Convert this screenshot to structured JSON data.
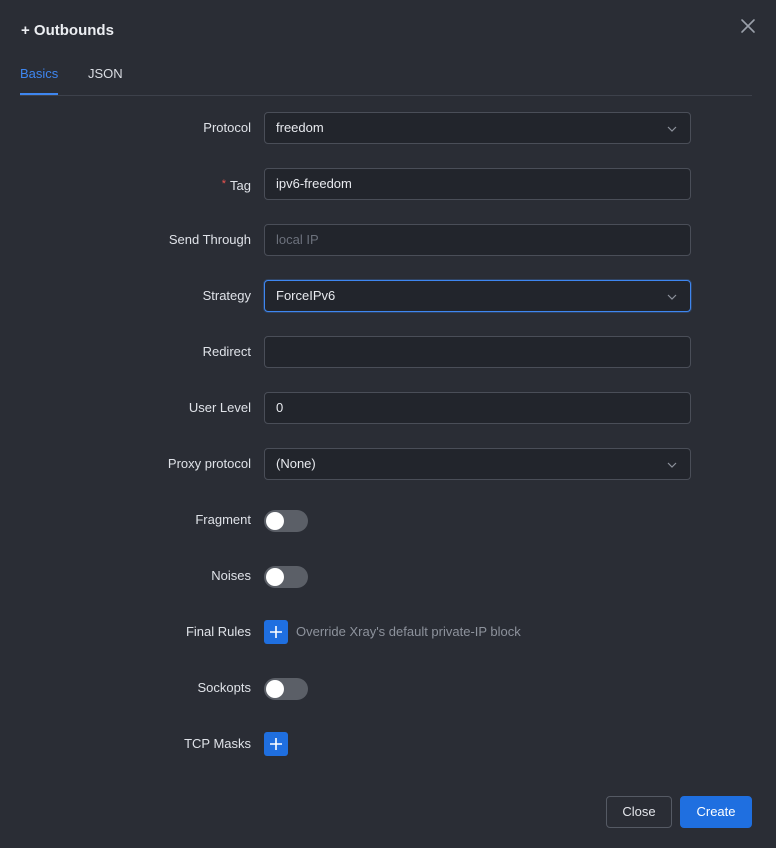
{
  "modal": {
    "title": "+ Outbounds",
    "close_icon": "close-icon"
  },
  "tabs": [
    {
      "label": "Basics",
      "active": true
    },
    {
      "label": "JSON",
      "active": false
    }
  ],
  "form": {
    "protocol": {
      "label": "Protocol",
      "value": "freedom"
    },
    "tag": {
      "label": "Tag",
      "required_mark": "*",
      "value": "ipv6-freedom"
    },
    "send_through": {
      "label": "Send Through",
      "value": "",
      "placeholder": "local IP"
    },
    "strategy": {
      "label": "Strategy",
      "value": "ForceIPv6"
    },
    "redirect": {
      "label": "Redirect",
      "value": ""
    },
    "user_level": {
      "label": "User Level",
      "value": "0"
    },
    "proxy_protocol": {
      "label": "Proxy protocol",
      "value": "(None)"
    },
    "fragment": {
      "label": "Fragment",
      "enabled": false
    },
    "noises": {
      "label": "Noises",
      "enabled": false
    },
    "final_rules": {
      "label": "Final Rules",
      "hint": "Override Xray's default private-IP block"
    },
    "sockopts": {
      "label": "Sockopts",
      "enabled": false
    },
    "tcp_masks": {
      "label": "TCP Masks"
    }
  },
  "footer": {
    "close_label": "Close",
    "create_label": "Create"
  },
  "colors": {
    "accent": "#1f6fe0",
    "background": "#2a2d35",
    "required": "#ef5350"
  }
}
